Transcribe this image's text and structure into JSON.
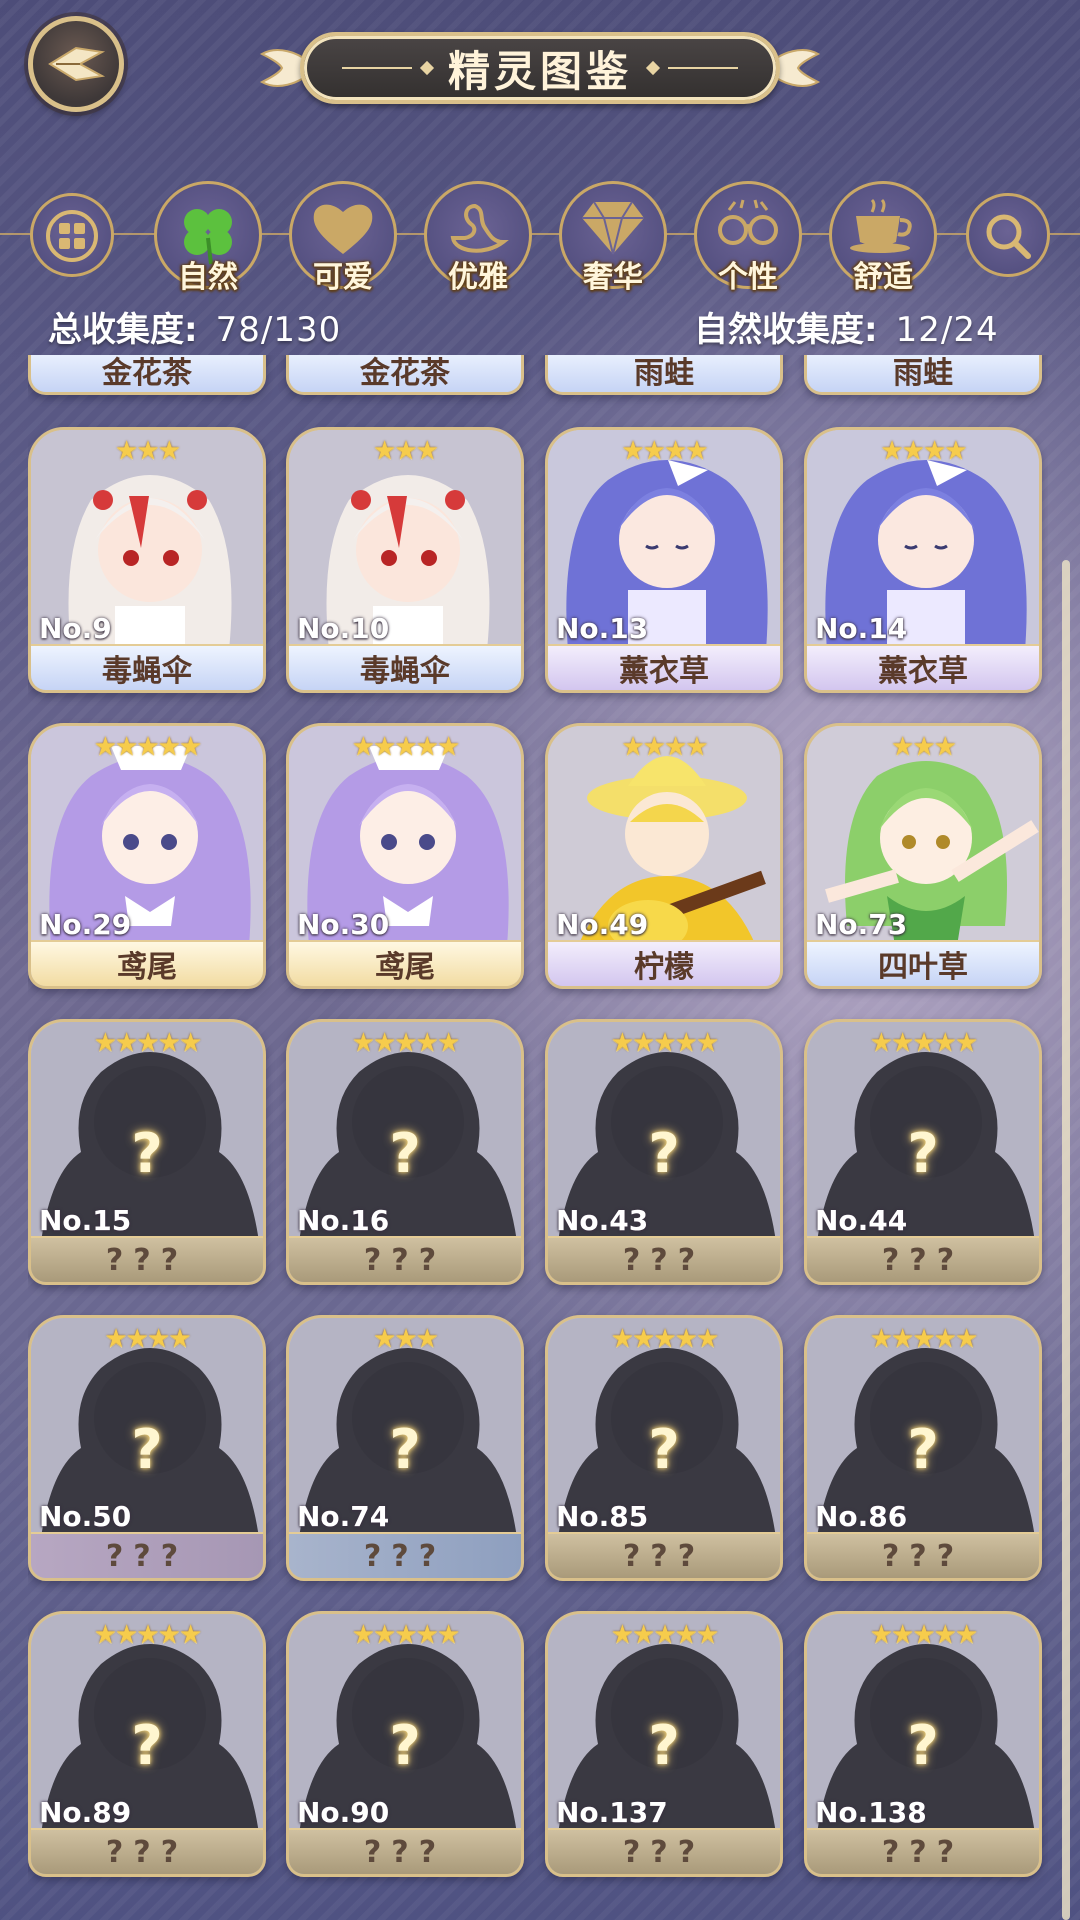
{
  "header": {
    "title": "精灵图鉴"
  },
  "categories": [
    {
      "name": "all",
      "label": ""
    },
    {
      "name": "nature",
      "label": "自然"
    },
    {
      "name": "cute",
      "label": "可爱"
    },
    {
      "name": "elegant",
      "label": "优雅"
    },
    {
      "name": "luxury",
      "label": "奢华"
    },
    {
      "name": "personality",
      "label": "个性"
    },
    {
      "name": "comfort",
      "label": "舒适"
    },
    {
      "name": "search",
      "label": ""
    }
  ],
  "stats": {
    "total_label": "总收集度:",
    "total_value": "78/130",
    "category_label": "自然收集度:",
    "category_value": "12/24"
  },
  "top_row": [
    "金花茶",
    "金花茶",
    "雨蛙",
    "雨蛙"
  ],
  "cards": [
    {
      "no": "No.9",
      "name": "毒蝇伞",
      "stars": "★★★",
      "style": "blue",
      "art": "white-red"
    },
    {
      "no": "No.10",
      "name": "毒蝇伞",
      "stars": "★★★",
      "style": "blue",
      "art": "white-red"
    },
    {
      "no": "No.13",
      "name": "薰衣草",
      "stars": "★★★★",
      "style": "purple",
      "art": "blue-hair"
    },
    {
      "no": "No.14",
      "name": "薰衣草",
      "stars": "★★★★",
      "style": "purple",
      "art": "blue-hair"
    },
    {
      "no": "No.29",
      "name": "鸢尾",
      "stars": "★★★★★",
      "style": "gold",
      "art": "lilac"
    },
    {
      "no": "No.30",
      "name": "鸢尾",
      "stars": "★★★★★",
      "style": "gold",
      "art": "lilac"
    },
    {
      "no": "No.49",
      "name": "柠檬",
      "stars": "★★★★",
      "style": "purple",
      "art": "lemon"
    },
    {
      "no": "No.73",
      "name": "四叶草",
      "stars": "★★★",
      "style": "blue",
      "art": "clover"
    },
    {
      "no": "No.15",
      "name": "???",
      "stars": "★★★★★",
      "style": "tan",
      "art": "unknown"
    },
    {
      "no": "No.16",
      "name": "???",
      "stars": "★★★★★",
      "style": "tan",
      "art": "unknown"
    },
    {
      "no": "No.43",
      "name": "???",
      "stars": "★★★★★",
      "style": "tan",
      "art": "unknown"
    },
    {
      "no": "No.44",
      "name": "???",
      "stars": "★★★★★",
      "style": "tan",
      "art": "unknown"
    },
    {
      "no": "No.50",
      "name": "???",
      "stars": "★★★★",
      "style": "lav",
      "art": "unknown"
    },
    {
      "no": "No.74",
      "name": "???",
      "stars": "★★★",
      "style": "steel",
      "art": "unknown"
    },
    {
      "no": "No.85",
      "name": "???",
      "stars": "★★★★★",
      "style": "tan",
      "art": "unknown"
    },
    {
      "no": "No.86",
      "name": "???",
      "stars": "★★★★★",
      "style": "tan",
      "art": "unknown"
    },
    {
      "no": "No.89",
      "name": "???",
      "stars": "★★★★★",
      "style": "tan",
      "art": "unknown"
    },
    {
      "no": "No.90",
      "name": "???",
      "stars": "★★★★★",
      "style": "tan",
      "art": "unknown"
    },
    {
      "no": "No.137",
      "name": "???",
      "stars": "★★★★★",
      "style": "tan",
      "art": "unknown"
    },
    {
      "no": "No.138",
      "name": "???",
      "stars": "★★★★★",
      "style": "tan",
      "art": "unknown"
    }
  ],
  "colors": {
    "gold_border": "#d9c08a",
    "star": "#f6cc4c",
    "title_bg": "#33302f"
  }
}
